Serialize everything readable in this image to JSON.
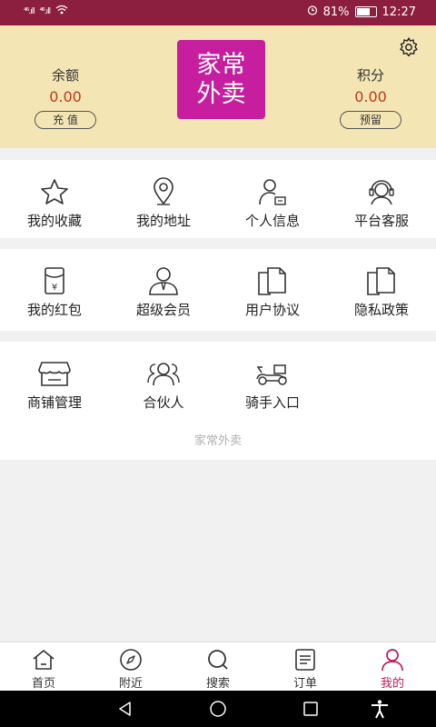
{
  "status": {
    "signal1": "⁴⁶.ıll",
    "signal2": "⁴⁶.ıll",
    "battery_pct": "81%",
    "time": "12:27",
    "battery_level": 0.81
  },
  "header": {
    "balance_label": "余额",
    "balance_value": "0.00",
    "recharge_label": "充 值",
    "logo_line1": "家常",
    "logo_line2": "外卖",
    "points_label": "积分",
    "points_value": "0.00",
    "reserve_label": "预留"
  },
  "menu1": [
    {
      "label": "我的收藏",
      "icon": "star-icon"
    },
    {
      "label": "我的地址",
      "icon": "location-pin-icon"
    },
    {
      "label": "个人信息",
      "icon": "user-card-icon"
    },
    {
      "label": "平台客服",
      "icon": "headset-icon"
    }
  ],
  "menu2": [
    {
      "label": "我的红包",
      "icon": "red-packet-icon"
    },
    {
      "label": "超级会员",
      "icon": "vip-member-icon"
    },
    {
      "label": "用户协议",
      "icon": "document-icon"
    },
    {
      "label": "隐私政策",
      "icon": "document-icon"
    }
  ],
  "menu3": [
    {
      "label": "商铺管理",
      "icon": "shop-icon"
    },
    {
      "label": "合伙人",
      "icon": "partners-icon"
    },
    {
      "label": "骑手入口",
      "icon": "scooter-icon"
    }
  ],
  "footer_note": "家常外卖",
  "tabs": [
    {
      "label": "首页",
      "icon": "home-icon"
    },
    {
      "label": "附近",
      "icon": "compass-icon"
    },
    {
      "label": "搜索",
      "icon": "search-icon"
    },
    {
      "label": "订单",
      "icon": "order-list-icon"
    },
    {
      "label": "我的",
      "icon": "profile-icon",
      "active": true
    }
  ],
  "colors": {
    "status_bar": "#8c1f3f",
    "header_bg": "#f4e6b4",
    "logo_bg": "#c61e9e",
    "amount": "#c03a1c",
    "active_tab": "#c2185b"
  }
}
